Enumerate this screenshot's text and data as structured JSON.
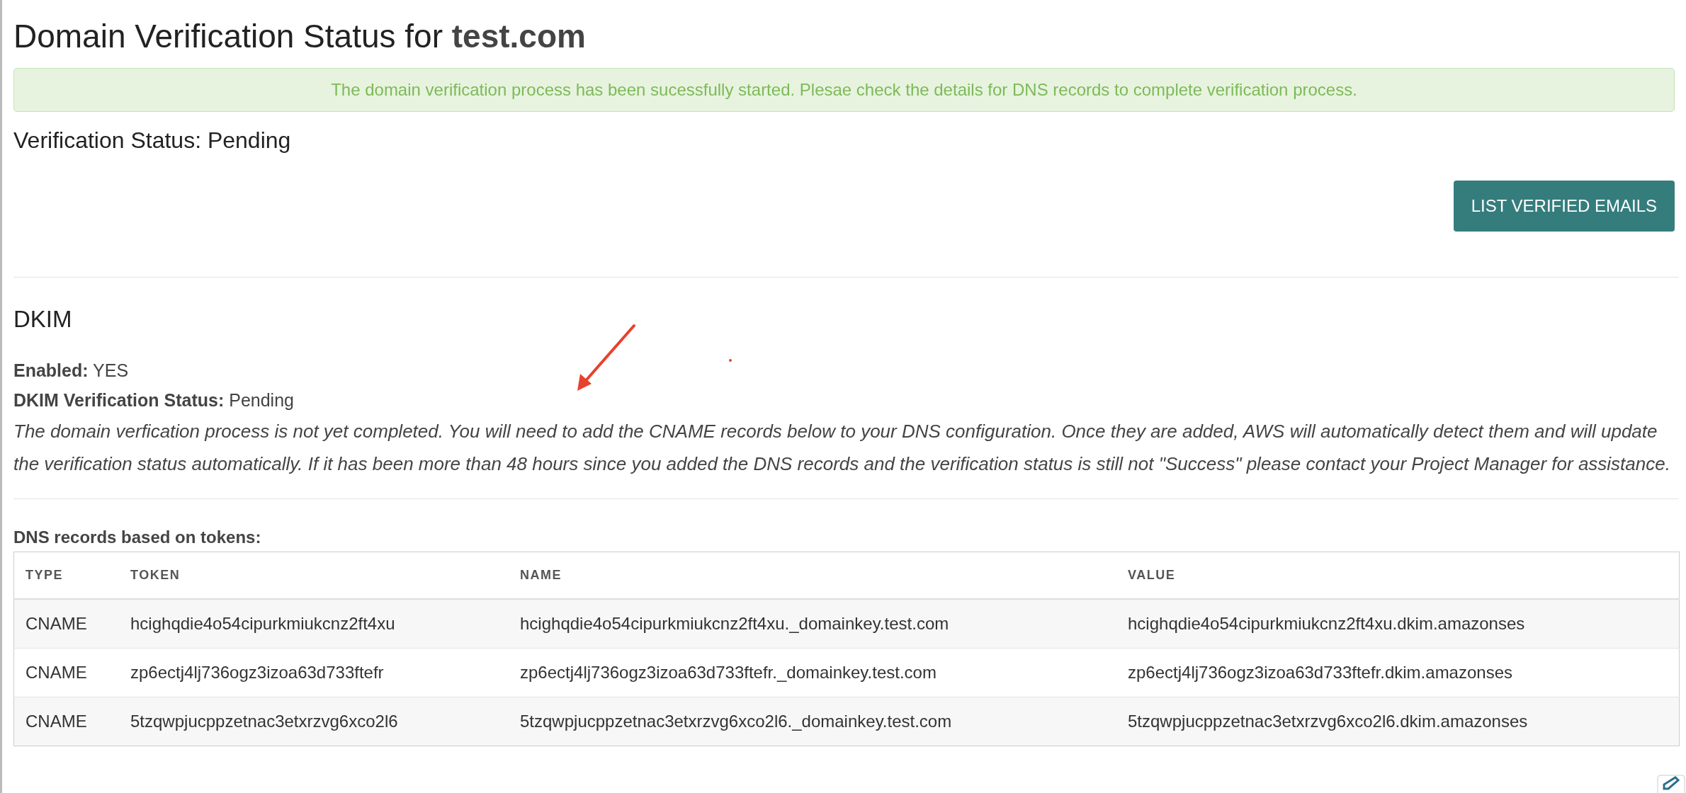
{
  "title": {
    "text": "Domain Verification Status for ",
    "domain": "test.com"
  },
  "alert": {
    "kind": "success",
    "text": "The domain verification process has been sucessfully started. Plesae check the details for DNS records to complete verification process."
  },
  "verification_status": "Verification Status: Pending",
  "button": "LIST VERIFIED EMAILS",
  "dkim": {
    "heading": "DKIM",
    "fields": [
      {
        "label": "Enabled:",
        "value": "YES"
      },
      {
        "label": "DKIM Verification Status:",
        "value": "Pending"
      }
    ],
    "note": "The domain verfication process is not yet completed. You will need to add the CNAME records below to your DNS configuration. Once they are added, AWS will automatically detect them and will update the verification status automatically. If it has been more than 48 hours since you added the DNS records and the verification status is still not \"Success\" please contact your Project Manager for assistance."
  },
  "table": {
    "caption": "DNS records based on tokens:",
    "columns": [
      "TYPE",
      "TOKEN",
      "NAME",
      "VALUE"
    ],
    "rows": [
      [
        "CNAME",
        "hcighqdie4o54cipurkmiukcnz2ft4xu",
        "hcighqdie4o54cipurkmiukcnz2ft4xu._domainkey.test.com",
        "hcighqdie4o54cipurkmiukcnz2ft4xu.dkim.amazonses"
      ],
      [
        "CNAME",
        "zp6ectj4lj736ogz3izoa63d733ftefr",
        "zp6ectj4lj736ogz3izoa63d733ftefr._domainkey.test.com",
        "zp6ectj4lj736ogz3izoa63d733ftefr.dkim.amazonses"
      ],
      [
        "CNAME",
        "5tzqwpjucppzetnac3etxrzvg6xco2l6",
        "5tzqwpjucppzetnac3etxrzvg6xco2l6._domainkey.test.com",
        "5tzqwpjucppzetnac3etxrzvg6xco2l6.dkim.amazonses"
      ]
    ]
  }
}
